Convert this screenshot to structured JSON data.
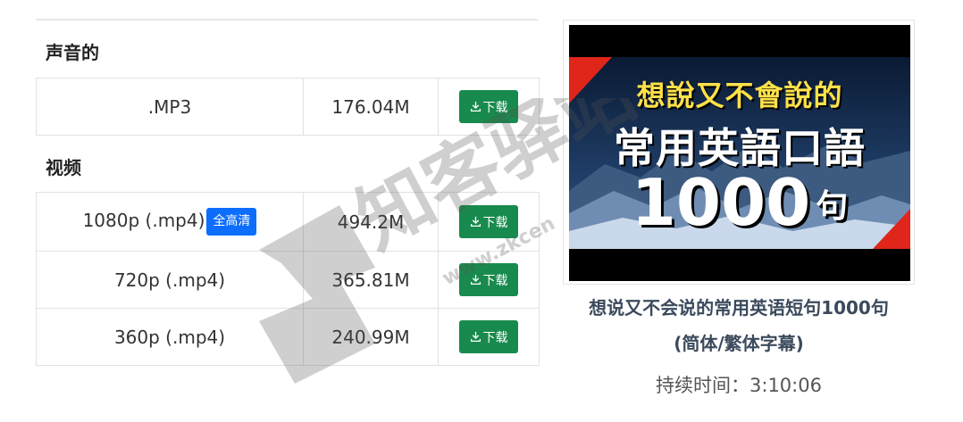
{
  "audio_section": {
    "title": "声音的",
    "rows": [
      {
        "format": ".MP3",
        "size": "176.04M",
        "download_label": "下载"
      }
    ]
  },
  "video_section": {
    "title": "视频",
    "rows": [
      {
        "format": "1080p (.mp4)",
        "badge": "全高清",
        "size": "494.2M",
        "download_label": "下载"
      },
      {
        "format": "720p (.mp4)",
        "size": "365.81M",
        "download_label": "下载"
      },
      {
        "format": "360p (.mp4)",
        "size": "240.99M",
        "download_label": "下载"
      }
    ]
  },
  "thumbnail": {
    "line1": "想說又不會說的",
    "line2": "常用英語口語",
    "line3_number": "1000",
    "line3_suffix": "句"
  },
  "video_info": {
    "title_line1": "想说又不会说的常用英语短句1000句",
    "title_line2": "(简体/繁体字幕)",
    "duration": "持续时间：3:10:06"
  },
  "watermark": {
    "text": "知客驿站",
    "url": "www.zkcen"
  },
  "colors": {
    "download_button": "#198a4e",
    "badge": "#0d6efd",
    "title_text": "#3b4a5c"
  },
  "icons": {
    "download": "download-tray-icon"
  }
}
